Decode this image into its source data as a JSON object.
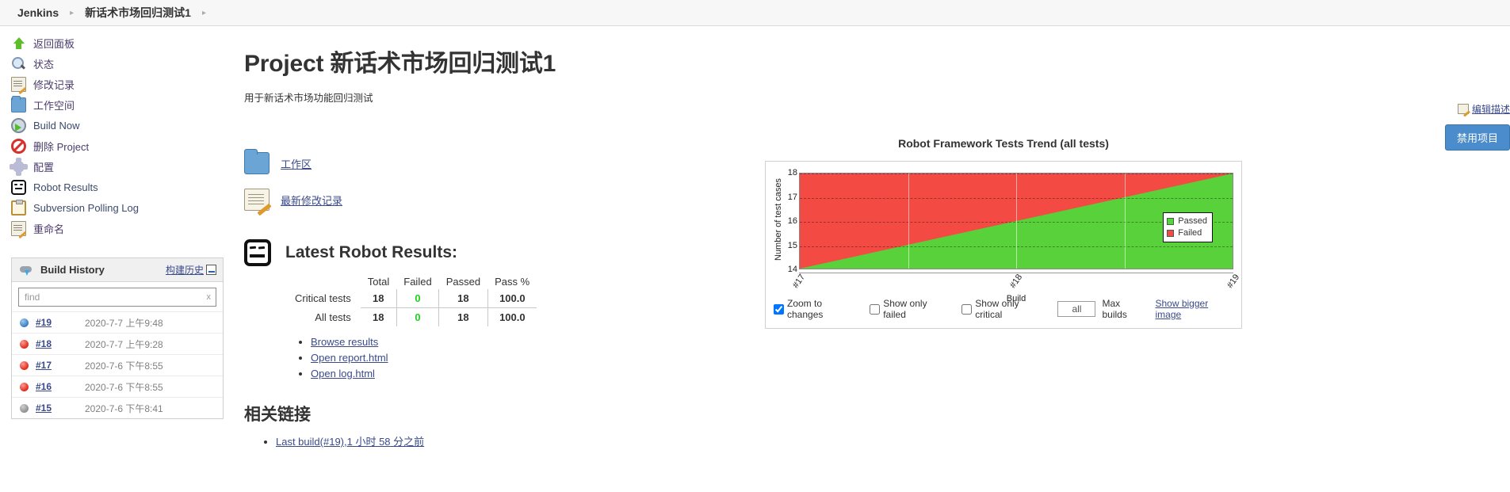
{
  "breadcrumb": {
    "root": "Jenkins",
    "project": "新话术市场回归测试1",
    "sep": "▸"
  },
  "sidebar": {
    "tasks": [
      {
        "label": "返回面板",
        "icon": "up-arrow-icon",
        "cls": "ic-up",
        "en": false
      },
      {
        "label": "状态",
        "icon": "search-icon",
        "cls": "ic-search",
        "en": false
      },
      {
        "label": "修改记录",
        "icon": "changes-note-icon",
        "cls": "ic-note",
        "en": false
      },
      {
        "label": "工作空间",
        "icon": "folder-icon",
        "cls": "ic-folder",
        "en": false
      },
      {
        "label": "Build Now",
        "icon": "build-clock-icon",
        "cls": "ic-clock",
        "en": true
      },
      {
        "label": "删除 Project",
        "icon": "delete-deny-icon",
        "cls": "ic-deny",
        "en": false
      },
      {
        "label": "配置",
        "icon": "gear-icon",
        "cls": "ic-gear",
        "en": false
      },
      {
        "label": "Robot Results",
        "icon": "robot-icon",
        "cls": "ic-robot",
        "en": true
      },
      {
        "label": "Subversion Polling Log",
        "icon": "clipboard-icon",
        "cls": "ic-clip",
        "en": true
      },
      {
        "label": "重命名",
        "icon": "rename-note-icon",
        "cls": "ic-note",
        "en": false
      }
    ]
  },
  "build_history": {
    "title": "Build History",
    "trend_link": "构建历史",
    "find_placeholder": "find",
    "find_value": "",
    "clear_glyph": "x",
    "builds": [
      {
        "number": "#19",
        "time": "2020-7-7 上午9:48",
        "status": "blue"
      },
      {
        "number": "#18",
        "time": "2020-7-7 上午9:28",
        "status": "red"
      },
      {
        "number": "#17",
        "time": "2020-7-6 下午8:55",
        "status": "red"
      },
      {
        "number": "#16",
        "time": "2020-7-6 下午8:55",
        "status": "red"
      },
      {
        "number": "#15",
        "time": "2020-7-6 下午8:41",
        "status": "grey"
      }
    ]
  },
  "main": {
    "title": "Project 新话术市场回归测试1",
    "description": "用于新话术市场功能回归测试",
    "edit_description": "编辑描述",
    "disable_button": "禁用项目",
    "quick_links": [
      {
        "label": "工作区",
        "icon": "folder-icon"
      },
      {
        "label": "最新修改记录",
        "icon": "changes-note-icon"
      }
    ],
    "robot_results": {
      "heading": "Latest Robot Results:",
      "columns": [
        "Total",
        "Failed",
        "Passed",
        "Pass %"
      ],
      "rows": [
        {
          "label": "Critical tests",
          "total": "18",
          "failed": "0",
          "passed": "18",
          "pass_pct": "100.0"
        },
        {
          "label": "All tests",
          "total": "18",
          "failed": "0",
          "passed": "18",
          "pass_pct": "100.0"
        }
      ],
      "links": [
        "Browse results",
        "Open report.html",
        "Open log.html"
      ]
    },
    "related": {
      "heading": "相关链接",
      "links": [
        "Last build(#19),1 小时 58 分之前"
      ]
    }
  },
  "chart_data": {
    "type": "area",
    "title": "Robot Framework Tests Trend (all tests)",
    "xlabel": "Build",
    "ylabel": "Number of test cases",
    "categories": [
      "#17",
      "#18",
      "#19"
    ],
    "series": [
      {
        "name": "Passed",
        "color": "#4ddb33",
        "values": [
          14,
          16,
          18
        ]
      },
      {
        "name": "Failed",
        "color": "#f34b44",
        "values": [
          4,
          2,
          0
        ]
      }
    ],
    "ylim": [
      14,
      18
    ],
    "yticks": [
      "18",
      "17",
      "16",
      "15",
      "14"
    ],
    "grid": true,
    "legend_position": "right",
    "stacked_total": 18
  },
  "chart_controls": {
    "zoom_to_changes": "Zoom to changes",
    "zoom_to_changes_checked": true,
    "show_only_failed": "Show only failed",
    "show_only_failed_checked": false,
    "show_only_critical": "Show only critical",
    "show_only_critical_checked": false,
    "max_builds_value": "all",
    "max_builds_label": "Max builds",
    "bigger_image": "Show bigger image"
  }
}
